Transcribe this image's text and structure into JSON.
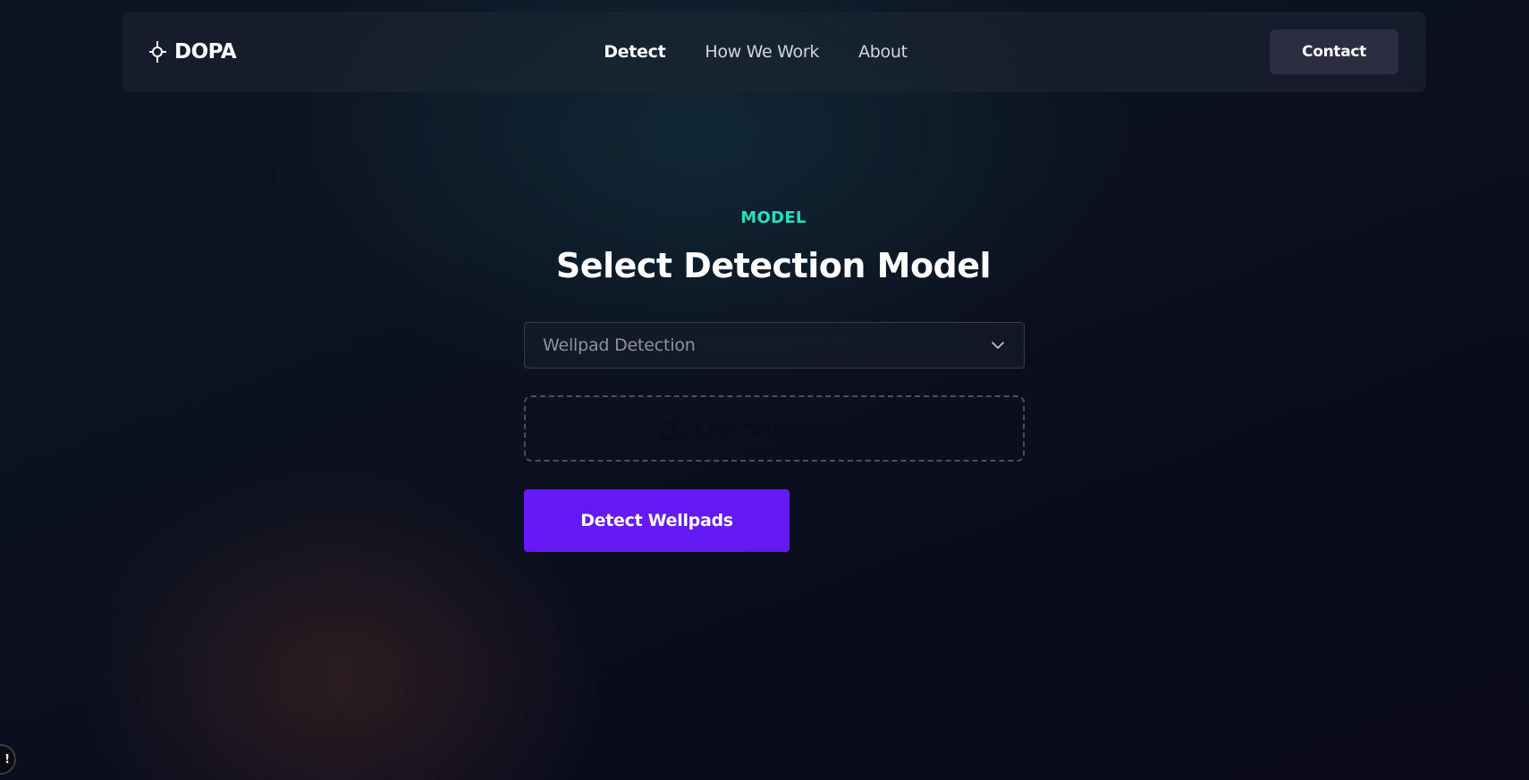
{
  "nav": {
    "brand": "DOPA",
    "links": [
      {
        "label": "Detect",
        "active": true
      },
      {
        "label": "How We Work",
        "active": false
      },
      {
        "label": "About",
        "active": false
      }
    ],
    "contact_label": "Contact"
  },
  "main": {
    "eyebrow": "MODEL",
    "title": "Select Detection Model",
    "model_select": {
      "selected": "Wellpad Detection",
      "icon": "chevron-down-icon"
    },
    "upload": {
      "label": "Click to upload image",
      "icon": "upload-icon"
    },
    "detect_button": "Detect Wellpads"
  },
  "corner_badge": "!",
  "colors": {
    "accent_teal": "#26e0c1",
    "primary_purple": "#6419f5",
    "contact_bg": "#2c2d40"
  }
}
